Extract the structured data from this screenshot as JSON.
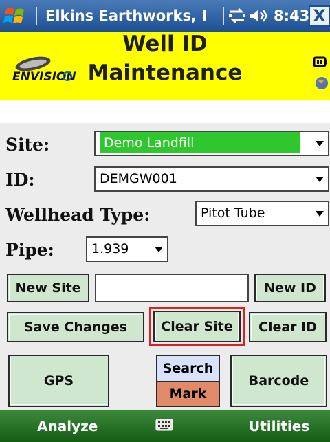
{
  "titlebar": {
    "title": "Elkins Earthworks, I",
    "time": "8:43",
    "close_label": "X",
    "icons": [
      "windows-start-icon",
      "connectivity-icon",
      "speaker-icon"
    ]
  },
  "header": {
    "brand_text": "ENVISION",
    "title_line1": "Well ID",
    "title_line2": "Maintenance",
    "icons": [
      "battery-icon",
      "globe-icon"
    ]
  },
  "form": {
    "site_label": "Site:",
    "site_value": "Demo Landfill",
    "id_label": "ID:",
    "id_value": "DEMGW001",
    "wellhead_label": "Wellhead Type:",
    "wellhead_value": "Pitot Tube",
    "pipe_label": "Pipe:",
    "pipe_value": "1.939",
    "new_site_text": ""
  },
  "buttons": {
    "new_site": "New Site",
    "new_id": "New ID",
    "save_changes": "Save Changes",
    "clear_site": "Clear Site",
    "clear_id": "Clear ID",
    "gps": "GPS",
    "search": "Search",
    "mark": "Mark",
    "barcode": "Barcode"
  },
  "colors": {
    "header_bg": "#ffff00",
    "site_select_bg": "#2ec82e",
    "button_bg": "#cfe6cf",
    "search_bg": "#d9e2fb",
    "mark_bg": "#e08a6a",
    "highlight": "#e02020",
    "titlebar_bg": "#1d4f93",
    "softkey_bg": "#155c15"
  },
  "softkeys": {
    "left": "Analyze",
    "right": "Utilities",
    "center_icon": "keyboard-icon"
  }
}
